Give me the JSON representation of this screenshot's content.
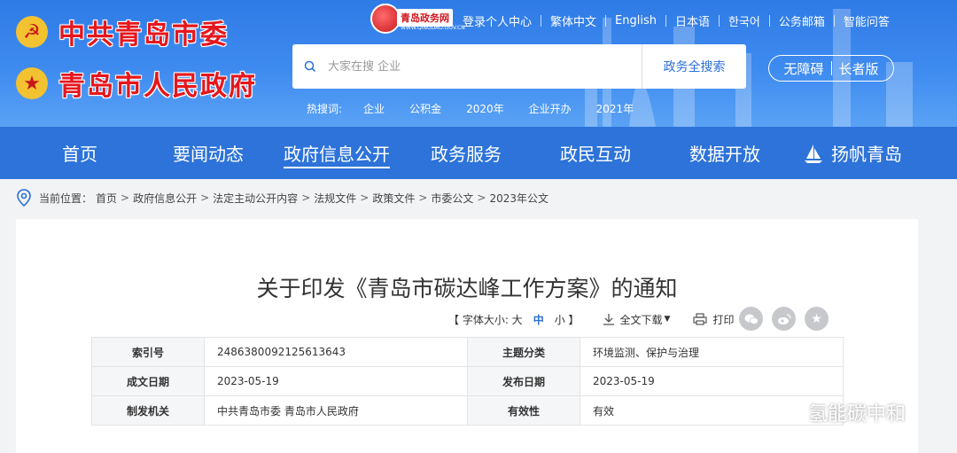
{
  "header": {
    "logo_party": "中共青岛市委",
    "logo_gov": "青岛市人民政府",
    "site_badge": "青岛政务网",
    "site_badge_sub": "WWW.QINGDAO.GOV.CN",
    "top_links": [
      "登录个人中心",
      "繁体中文",
      "English",
      "日本语",
      "한국어",
      "公务邮箱",
      "智能问答"
    ],
    "search": {
      "placeholder": "大家在搜 企业",
      "button": "政务全搜索"
    },
    "accessibility": {
      "barrier_free": "无障碍",
      "elder": "长者版"
    },
    "hot_search": {
      "label": "热搜词:",
      "keywords": [
        "企业",
        "公积金",
        "2020年",
        "企业开办",
        "2021年"
      ]
    }
  },
  "nav": {
    "items": [
      "首页",
      "要闻动态",
      "政府信息公开",
      "政务服务",
      "政民互动",
      "数据开放",
      "扬帆青岛"
    ],
    "active_index": 2
  },
  "breadcrumb": {
    "prefix": "当前位置：",
    "items": [
      "首页",
      "政府信息公开",
      "法定主动公开内容",
      "法规文件",
      "政策文件",
      "市委公文",
      "2023年公文"
    ]
  },
  "document": {
    "title": "关于印发《青岛市碳达峰工作方案》的通知",
    "tools": {
      "font_size_label": "【 字体大小: 大",
      "font_mid": "中",
      "font_small": "小 】",
      "download": "全文下载",
      "print": "打印"
    },
    "meta": [
      {
        "k1": "索引号",
        "v1": "2486380092125613643",
        "k2": "主题分类",
        "v2": "环境监测、保护与治理"
      },
      {
        "k1": "成文日期",
        "v1": "2023-05-19",
        "k2": "发布日期",
        "v2": "2023-05-19"
      },
      {
        "k1": "制发机关",
        "v1": "中共青岛市委 青岛市人民政府",
        "k2": "有效性",
        "v2": "有效"
      }
    ]
  },
  "watermark": {
    "text": "氢能碳中和"
  },
  "colors": {
    "header_blue": "#3e8bf0",
    "nav_blue": "#2d73d9",
    "logo_red": "#e5161d",
    "accent": "#2a6fd8"
  }
}
